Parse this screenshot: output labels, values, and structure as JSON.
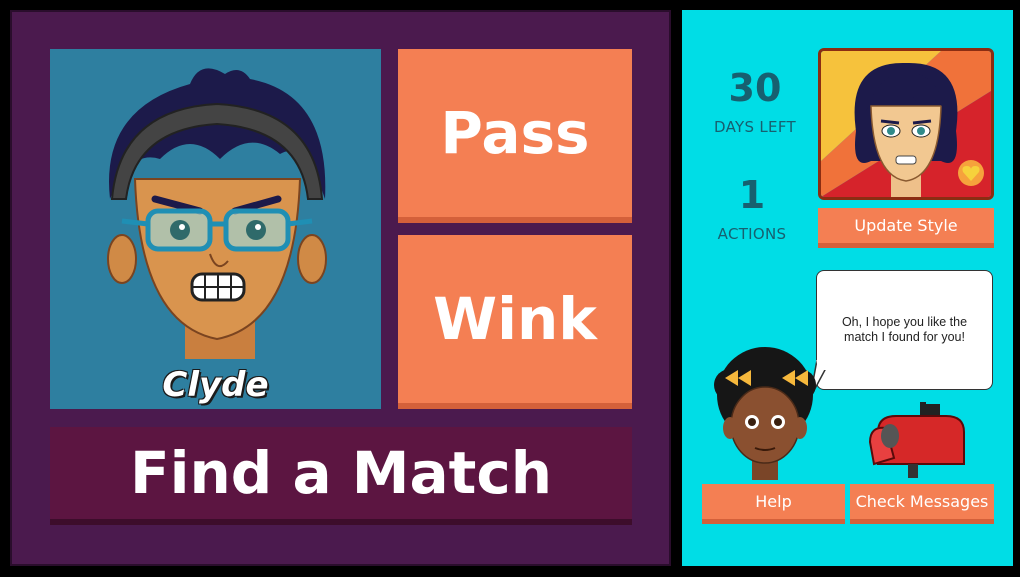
{
  "profile": {
    "name": "Clyde"
  },
  "actions": {
    "pass_label": "Pass",
    "wink_label": "Wink",
    "find_label": "Find a Match"
  },
  "stats": {
    "days_value": "30",
    "days_label": "DAYS LEFT",
    "actions_value": "1",
    "actions_label": "ACTIONS"
  },
  "style": {
    "update_label": "Update Style"
  },
  "helper": {
    "message": "Oh, I hope you like the match I found for you!"
  },
  "footer": {
    "help_label": "Help",
    "messages_label": "Check Messages"
  },
  "colors": {
    "left_panel": "#4b1a4e",
    "right_panel": "#00dde6",
    "button": "#f47f53",
    "find_button": "#5c1541"
  }
}
